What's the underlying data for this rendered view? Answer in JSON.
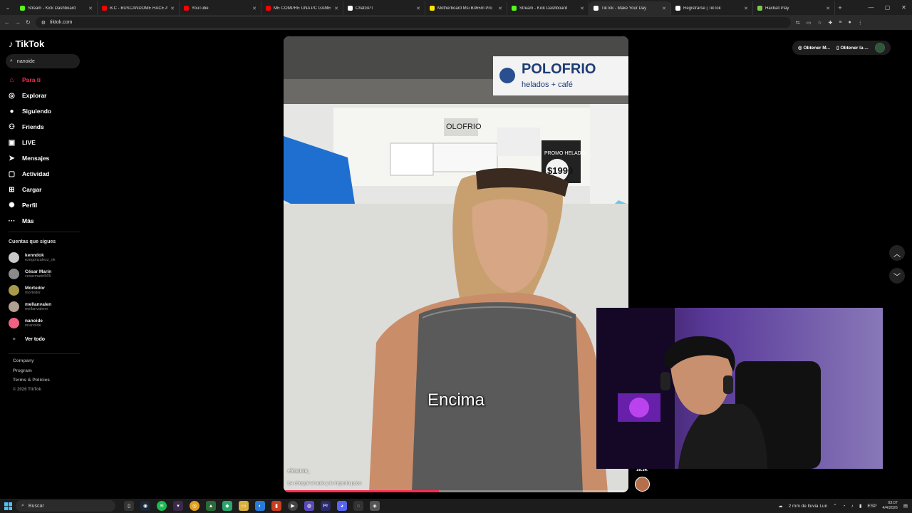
{
  "browser": {
    "tabs": [
      {
        "title": "Stream - Kick Dashboard",
        "color": "#53fc18"
      },
      {
        "title": "B.C - BUSCANDOME HACE A?",
        "color": "#ff0000"
      },
      {
        "title": "YouTube",
        "color": "#ff0000"
      },
      {
        "title": "ME COMPRE UNA PC GAMER",
        "color": "#ff0000"
      },
      {
        "title": "ChatGPT",
        "color": "#ffffff"
      },
      {
        "title": "Motherboard Msi B365m Pro",
        "color": "#ffe600"
      },
      {
        "title": "Stream - Kick Dashboard",
        "color": "#53fc18"
      },
      {
        "title": "TikTok - Make Your Day",
        "color": "#ffffff",
        "active": true
      },
      {
        "title": "Registrarse | TikTok",
        "color": "#ffffff"
      },
      {
        "title": "Haxball Play",
        "color": "#7ec850"
      }
    ],
    "url": "tiktok.com"
  },
  "tiktok": {
    "logo": "TikTok",
    "search_value": "nanoide",
    "nav": [
      {
        "label": "Para ti",
        "icon": "home-icon",
        "glyph": "⌂",
        "active": true
      },
      {
        "label": "Explorar",
        "icon": "compass-icon",
        "glyph": "◎"
      },
      {
        "label": "Siguiendo",
        "icon": "following-icon",
        "glyph": "●"
      },
      {
        "label": "Friends",
        "icon": "friends-icon",
        "glyph": "⚇"
      },
      {
        "label": "LIVE",
        "icon": "live-icon",
        "glyph": "▣"
      },
      {
        "label": "Mensajes",
        "icon": "messages-icon",
        "glyph": "➤",
        "badge": true
      },
      {
        "label": "Actividad",
        "icon": "activity-icon",
        "glyph": "▢"
      },
      {
        "label": "Cargar",
        "icon": "upload-icon",
        "glyph": "⊞"
      },
      {
        "label": "Perfil",
        "icon": "profile-icon",
        "glyph": "✺"
      },
      {
        "label": "Más",
        "icon": "more-icon",
        "glyph": "···"
      }
    ],
    "following_title": "Cuentas que sigues",
    "following": [
      {
        "name": "kenndok",
        "handle": "ezegonzalezz_ok",
        "color": "#c9c9c9"
      },
      {
        "name": "César Marín",
        "handle": "cesarmarin565",
        "color": "#8a8a8a"
      },
      {
        "name": "Mortedor",
        "handle": "mortedor",
        "color": "#a79a4a"
      },
      {
        "name": "mellanvalen",
        "handle": "mellanvalenn",
        "color": "#b0a090"
      },
      {
        "name": "nanoide",
        "handle": "nnanoide",
        "color": "#f06080"
      }
    ],
    "see_all": "Ver todo",
    "footer": [
      "Company",
      "Program",
      "Terms & Policies"
    ],
    "copyright": "© 2026 TikTok",
    "top_buttons": [
      "Obtener M...",
      "Obtener la ..."
    ],
    "video": {
      "caption": "Encima",
      "author": "elmuruu_",
      "description": "Le choqué el auto y le importó poco",
      "progress": 0.45,
      "likes": "16.3K"
    }
  },
  "taskbar": {
    "search_placeholder": "Buscar",
    "weather": "2 mm de lluvia Lun",
    "lang": "ESP",
    "time": "03:07",
    "date": "4/4/2026"
  }
}
